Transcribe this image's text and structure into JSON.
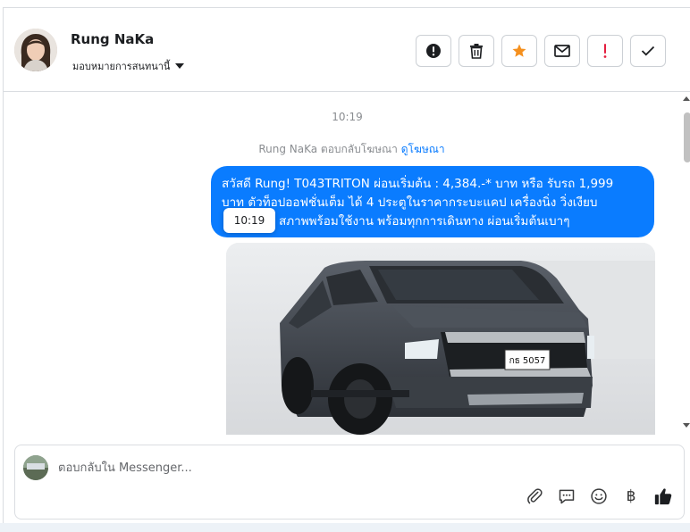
{
  "contact": {
    "name": "Rung NaKa",
    "assign_label": "มอบหมายการสนทนานี้"
  },
  "conversation": {
    "timestamp": "10:19",
    "reply_note": "Rung NaKa ตอบกลับโฆษณา",
    "view_ad_link": "ดูโฆษณา",
    "message_line1": "สวัสดี Rung! T043TRITON ผ่อนเริ่มต้น : 4,384.-* บาท หรือ รับรถ 1,999",
    "message_line2": "บาท ตัวท็อปออฟชั่นเต็ม ได้ 4 ประตูในราคากระบะแคป เครื่องนิ่ง วิ่งเงียบ",
    "message_line3": "สภาพพร้อมใช้งาน พร้อมทุกการเดินทาง ผ่อนเริ่มต้นเบาๆ",
    "tooltip_time": "10:19",
    "plate_text": "กธ 5057"
  },
  "composer": {
    "placeholder": "ตอบกลับใน Messenger..."
  },
  "colors": {
    "bubble": "#0a7cff",
    "star": "#f5901e",
    "alert": "#e41e3f"
  },
  "icons": {
    "spam": "exclamation-circle-icon",
    "delete": "trash-icon",
    "star": "star-icon",
    "unread": "envelope-icon",
    "follow_up": "exclamation-icon",
    "done": "checkmark-icon"
  }
}
